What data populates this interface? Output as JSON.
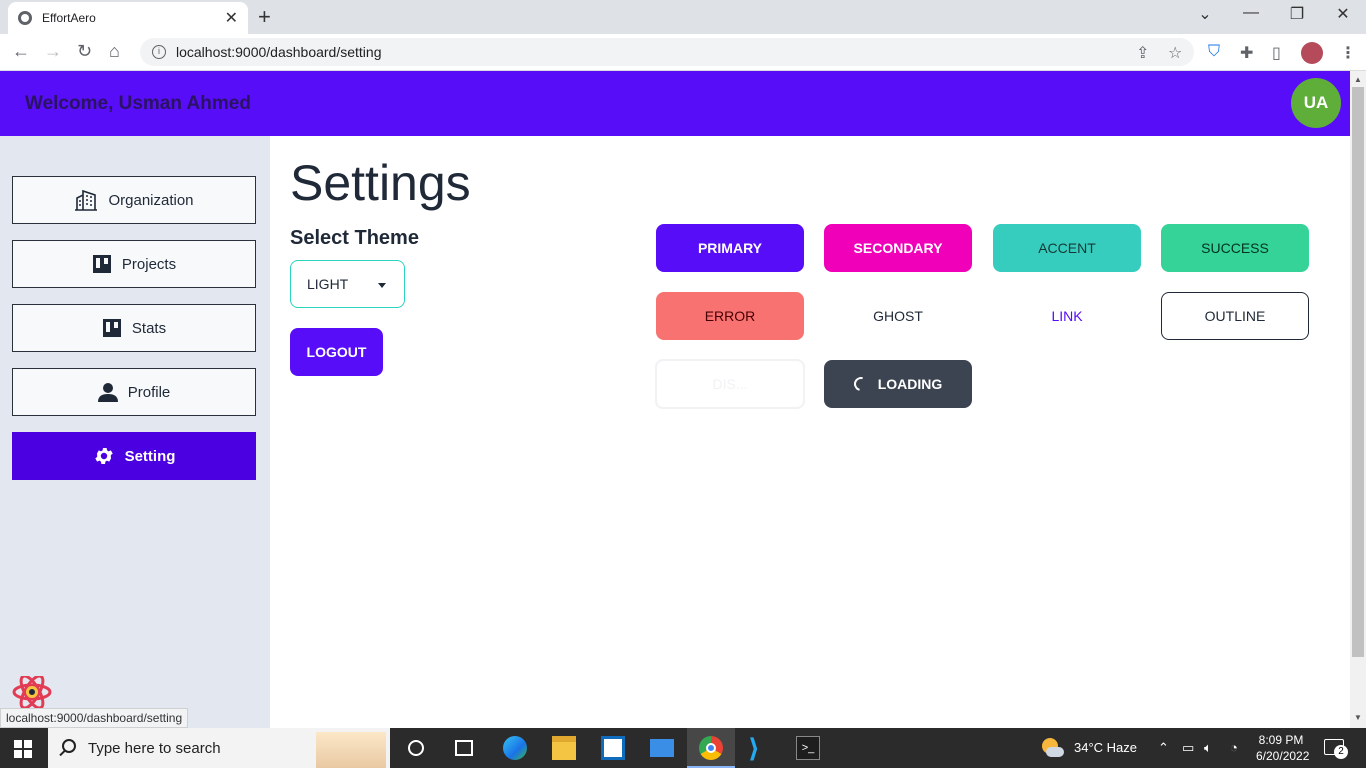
{
  "browser": {
    "tab_title": "EffortAero",
    "url": "localhost:9000/dashboard/setting",
    "status_url": "localhost:9000/dashboard/setting"
  },
  "header": {
    "welcome": "Welcome, Usman Ahmed",
    "avatar_initials": "UA"
  },
  "sidebar": {
    "items": [
      {
        "label": "Organization",
        "icon": "building-icon"
      },
      {
        "label": "Projects",
        "icon": "board-icon"
      },
      {
        "label": "Stats",
        "icon": "board-icon"
      },
      {
        "label": "Profile",
        "icon": "person-icon"
      },
      {
        "label": "Setting",
        "icon": "gear-icon",
        "active": true
      }
    ]
  },
  "settings": {
    "title": "Settings",
    "theme_label": "Select Theme",
    "theme_value": "LIGHT",
    "logout_label": "LOGOUT"
  },
  "buttons": {
    "primary": "PRIMARY",
    "secondary": "SECONDARY",
    "accent": "ACCENT",
    "success": "SUCCESS",
    "error": "ERROR",
    "ghost": "GHOST",
    "link": "LINK",
    "outline": "OUTLINE",
    "disabled": "DIS...",
    "loading": "LOADING"
  },
  "colors": {
    "primary": "#570df8",
    "secondary": "#f000b8",
    "accent": "#37cdbe",
    "success": "#36d399",
    "error": "#f87272",
    "neutral": "#3d4451"
  },
  "taskbar": {
    "search_placeholder": "Type here to search",
    "weather": "34°C  Haze",
    "time": "8:09 PM",
    "date": "6/20/2022",
    "notifications": "2"
  }
}
